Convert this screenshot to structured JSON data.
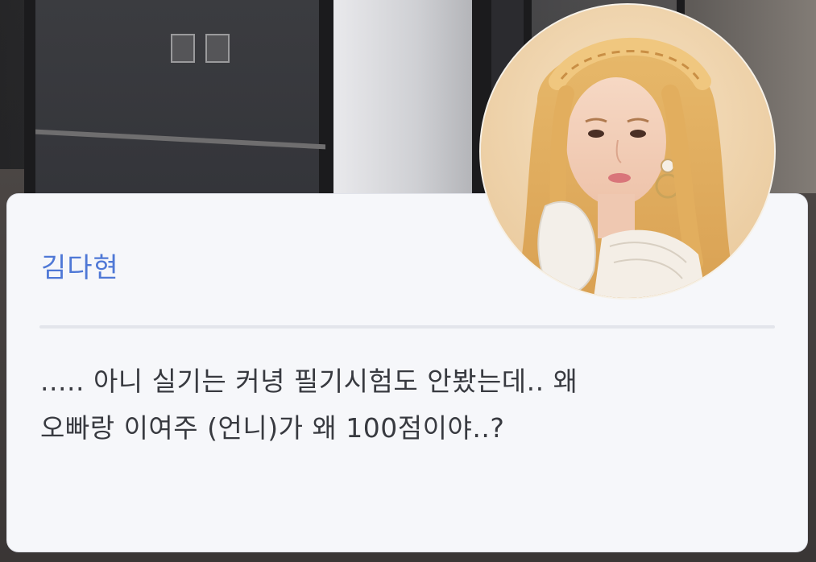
{
  "card": {
    "author_name": "김다현",
    "message": "..... 아니 실기는 커녕 필기시험도 안봤는데.. 왜\n오빠랑 이여주 (언니)가 왜 100점이야..?"
  },
  "avatar": {
    "icon": "profile-photo",
    "accent_color": "#4f78d6"
  },
  "colors": {
    "card_bg": "#f6f7fa",
    "name_color": "#4f78d6",
    "text_color": "#383a40",
    "divider": "#e3e5eb"
  }
}
